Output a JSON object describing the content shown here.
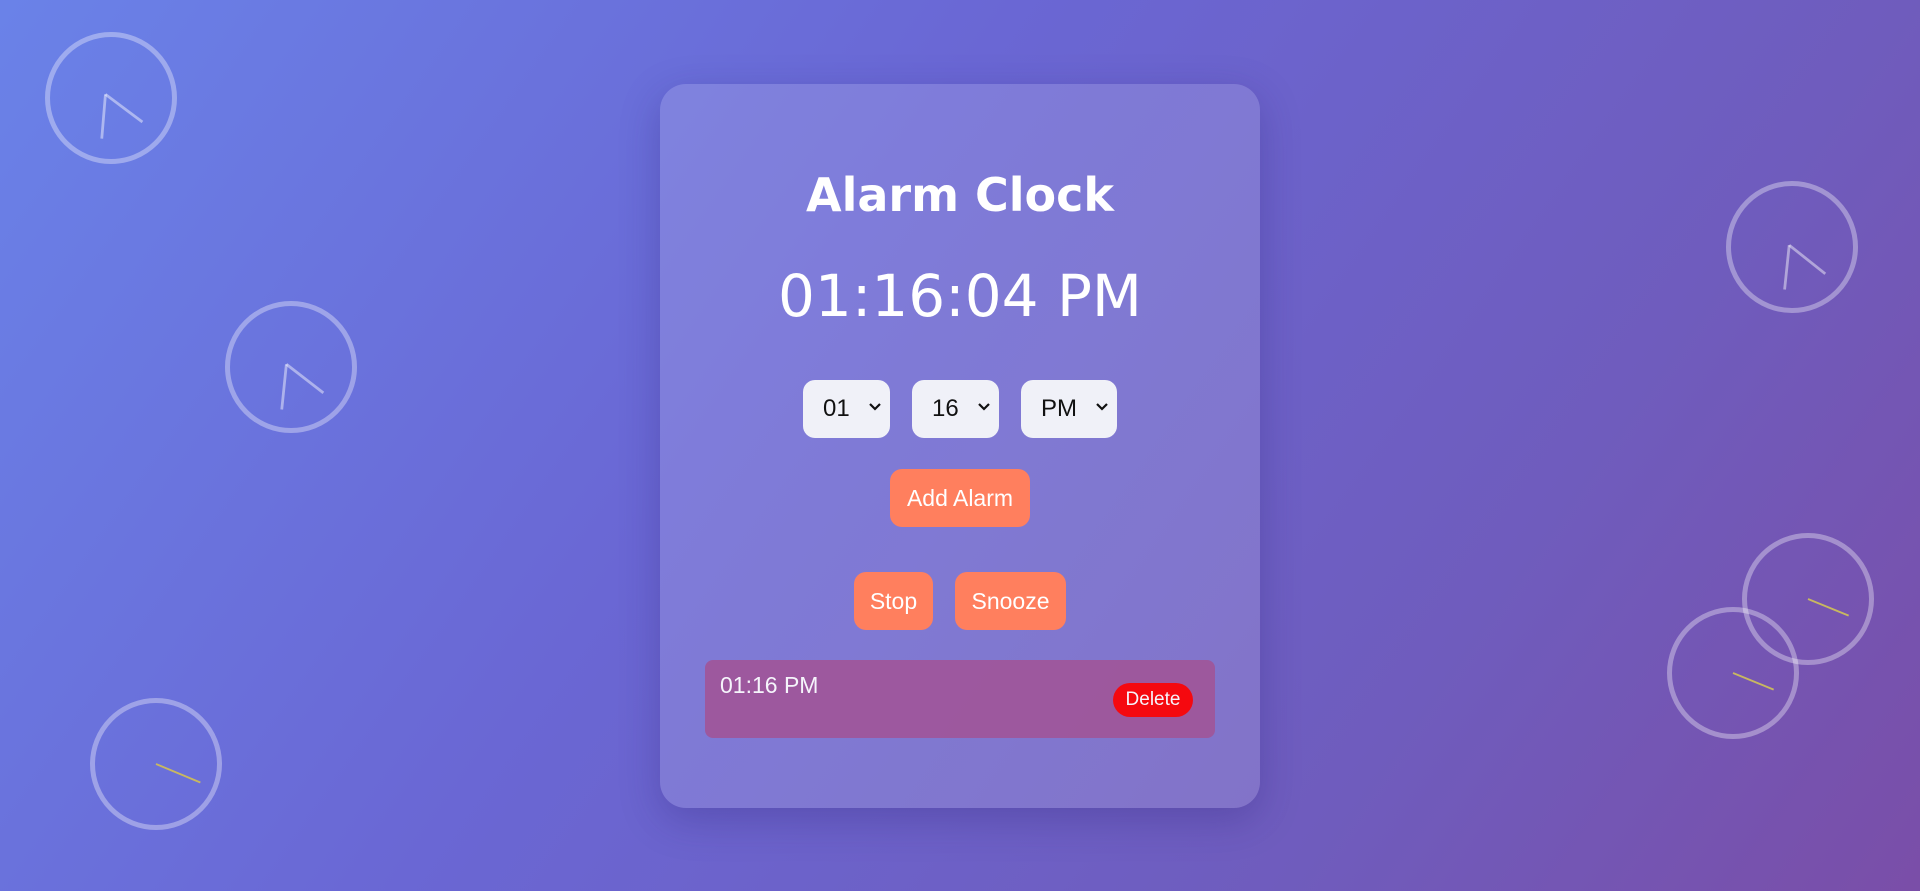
{
  "app": {
    "title": "Alarm Clock",
    "current_time": "01:16:04 PM"
  },
  "selectors": {
    "hour": "01",
    "minute": "16",
    "period": "PM"
  },
  "buttons": {
    "add_alarm": "Add Alarm",
    "stop": "Stop",
    "snooze": "Snooze"
  },
  "alarms": [
    {
      "time": "01:16 PM",
      "delete_label": "Delete"
    }
  ],
  "colors": {
    "accent_button": "#ff7f5e",
    "delete_button": "#ff0000",
    "alarm_item": "#a0569a"
  },
  "icons": {
    "decorations": "clock-icon",
    "select_arrow": "chevron-down-icon"
  }
}
